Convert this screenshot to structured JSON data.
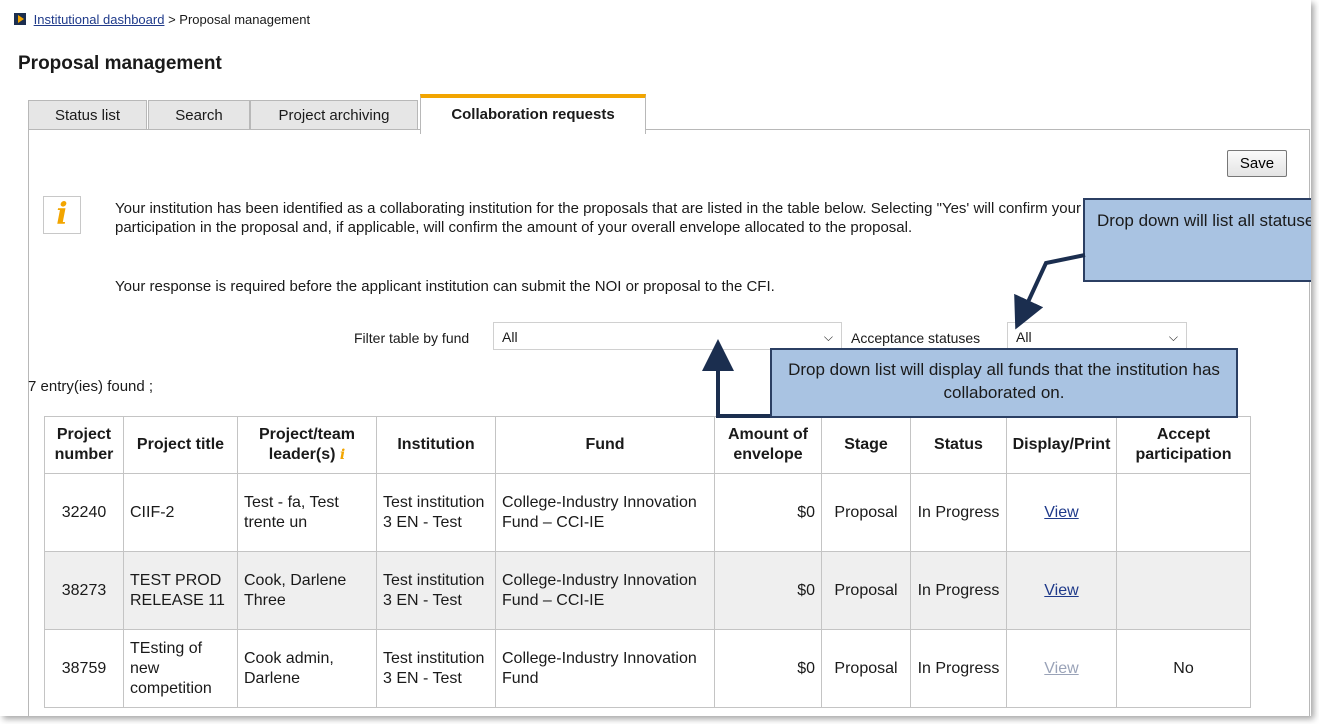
{
  "breadcrumb": {
    "link": "Institutional dashboard",
    "separator": ">",
    "current": "Proposal management"
  },
  "page_title": "Proposal management",
  "tabs": [
    {
      "label": "Status list"
    },
    {
      "label": "Search"
    },
    {
      "label": "Project archiving"
    },
    {
      "label": "Collaboration requests",
      "active": true
    }
  ],
  "save_label": "Save",
  "info": {
    "line1": "Your institution has been identified as a collaborating institution for the proposals that are listed in the table below. Selecting \"Yes' will confirm your participation in the proposal and, if applicable, will confirm the amount of your overall envelope allocated to the proposal.",
    "line2": "Your response is required before the applicant institution can submit the NOI or proposal to the CFI."
  },
  "filters": {
    "fund_label": "Filter table by fund",
    "fund_value": "All",
    "status_label": "Acceptance statuses",
    "status_value": "All"
  },
  "entries_text": "7 entry(ies) found ;",
  "columns": [
    "Project number",
    "Project title",
    "Project/team leader(s)",
    "Institution",
    "Fund",
    "Amount of envelope",
    "Stage",
    "Status",
    "Display/Print",
    "Accept participation"
  ],
  "rows": [
    {
      "number": "32240",
      "title": "CIIF-2",
      "leader": "Test - fa, Test trente un",
      "institution": "Test institution 3 EN - Test",
      "fund": "College-Industry Innovation Fund – CCI-IE",
      "amount": "$0",
      "stage": "Proposal",
      "status": "In Progress",
      "display": "View",
      "accept": ""
    },
    {
      "number": "38273",
      "title": "TEST PROD RELEASE 11",
      "leader": "Cook, Darlene Three",
      "institution": "Test institution 3 EN - Test",
      "fund": "College-Industry Innovation Fund – CCI-IE",
      "amount": "$0",
      "stage": "Proposal",
      "status": "In Progress",
      "display": "View",
      "accept": ""
    },
    {
      "number": "38759",
      "title": "TEsting of new competition",
      "leader": "Cook admin, Darlene",
      "institution": "Test institution 3 EN - Test",
      "fund": "College-Industry Innovation Fund",
      "amount": "$0",
      "stage": "Proposal",
      "status": "In Progress",
      "display": "View",
      "accept": "No"
    }
  ],
  "callouts": {
    "statuses": "Drop down will list all statuses the institution can filter by.",
    "funds": "Drop down list will display all funds that the institution has collaborated on."
  },
  "colors": {
    "accent": "#f2a500",
    "callout_fill": "#a9c3e2",
    "callout_border": "#2b3f63",
    "link": "#1f3a8a"
  }
}
